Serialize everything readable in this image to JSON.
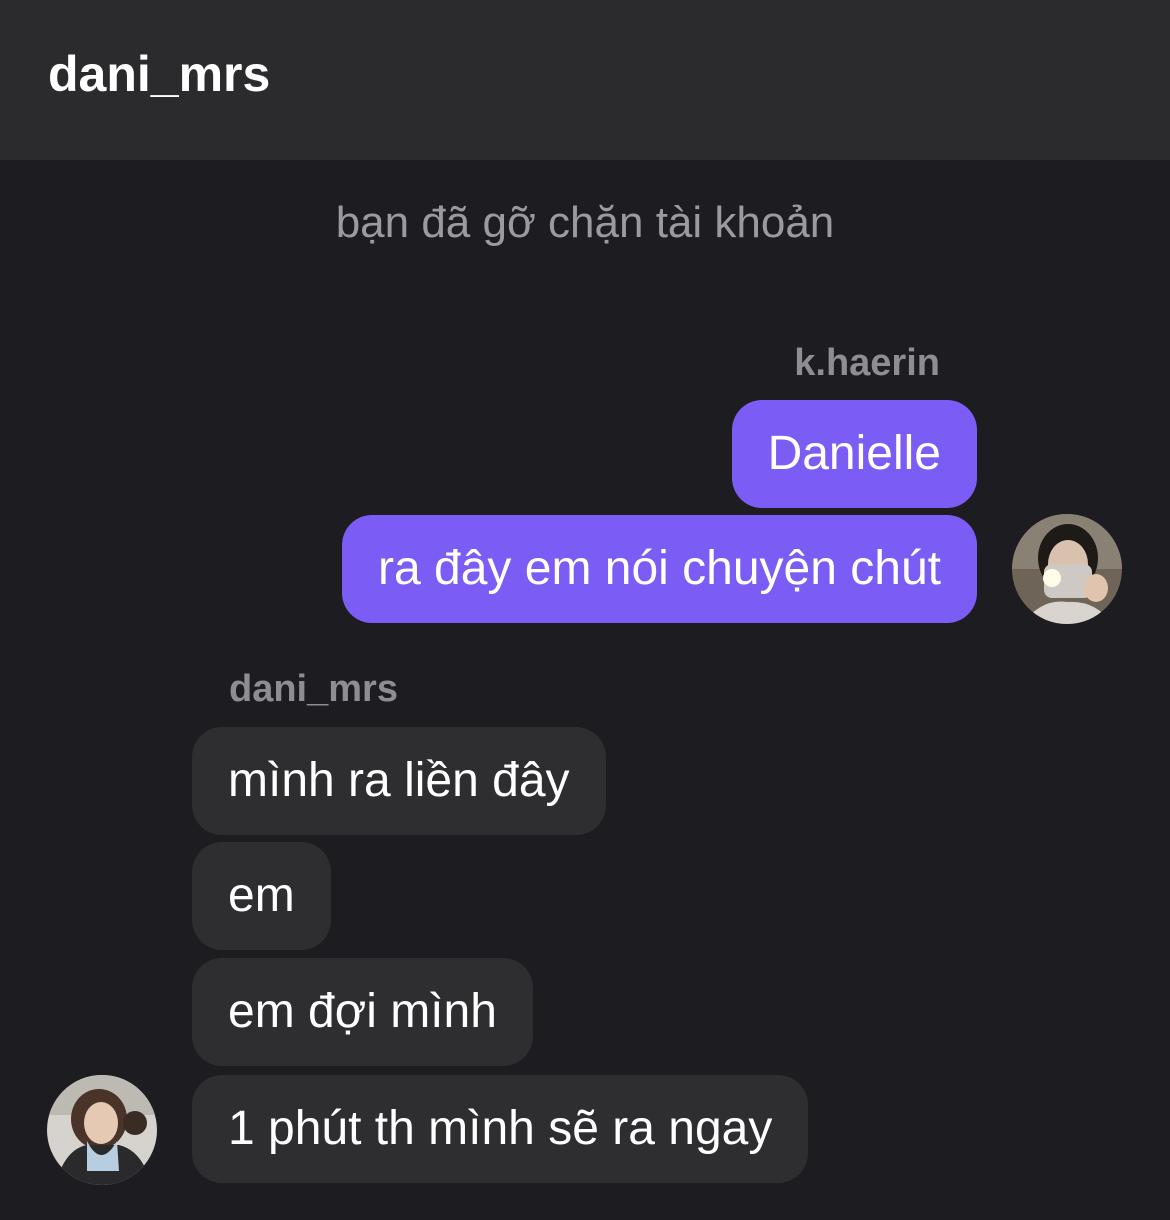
{
  "header": {
    "title": "dani_mrs"
  },
  "system_notice": "bạn đã gỡ chặn tài khoản",
  "groups": {
    "outgoing": {
      "sender": "k.haerin",
      "avatar_icon": "user-avatar-icon",
      "messages": [
        "Danielle",
        "ra đây em nói chuyện chút"
      ]
    },
    "incoming": {
      "sender": "dani_mrs",
      "avatar_icon": "user-avatar-icon",
      "messages": [
        "mình ra liền đây",
        "em",
        "em đợi mình",
        "1 phút th mình sẽ ra ngay"
      ]
    }
  },
  "colors": {
    "background": "#1c1c21",
    "header": "#2b2b2e",
    "outgoing_bubble": "#7b5cf5",
    "incoming_bubble": "#2e2e31",
    "muted_text": "#9b9aa1"
  }
}
